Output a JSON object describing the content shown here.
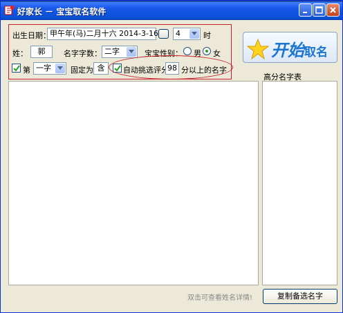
{
  "window": {
    "title": "好家长 － 宝宝取名软件"
  },
  "form": {
    "birth_label": "出生日期：",
    "birth_value": "甲午年(马)二月十六 2014-3-16",
    "hour_value": "4",
    "hour_unit": "时",
    "surname_label": "姓：",
    "surname_value": "郭",
    "namelen_label": "名字字数：",
    "namelen_value": "二字",
    "gender_label": "宝宝性别：",
    "gender_male": "男",
    "gender_female": "女",
    "gender_selected": "女",
    "fix_checked": true,
    "fix_prefix": "第",
    "fix_position_value": "一字",
    "fix_label": "固定为",
    "fix_char_value": "含",
    "auto_checked": true,
    "auto_label": "自动挑选评分",
    "auto_score_value": "98",
    "auto_suffix": "分以上的名字"
  },
  "start": {
    "label_big": "开始",
    "label_small": "取名"
  },
  "high_score": {
    "title": "高分名字表"
  },
  "bottom": {
    "hint": "双击可查看姓名详情!",
    "copy_button": "复制备选名字"
  },
  "colors": {
    "title_bar": "#0a50d6",
    "highlight_border": "#c8202a",
    "accent": "#1b75d1"
  }
}
